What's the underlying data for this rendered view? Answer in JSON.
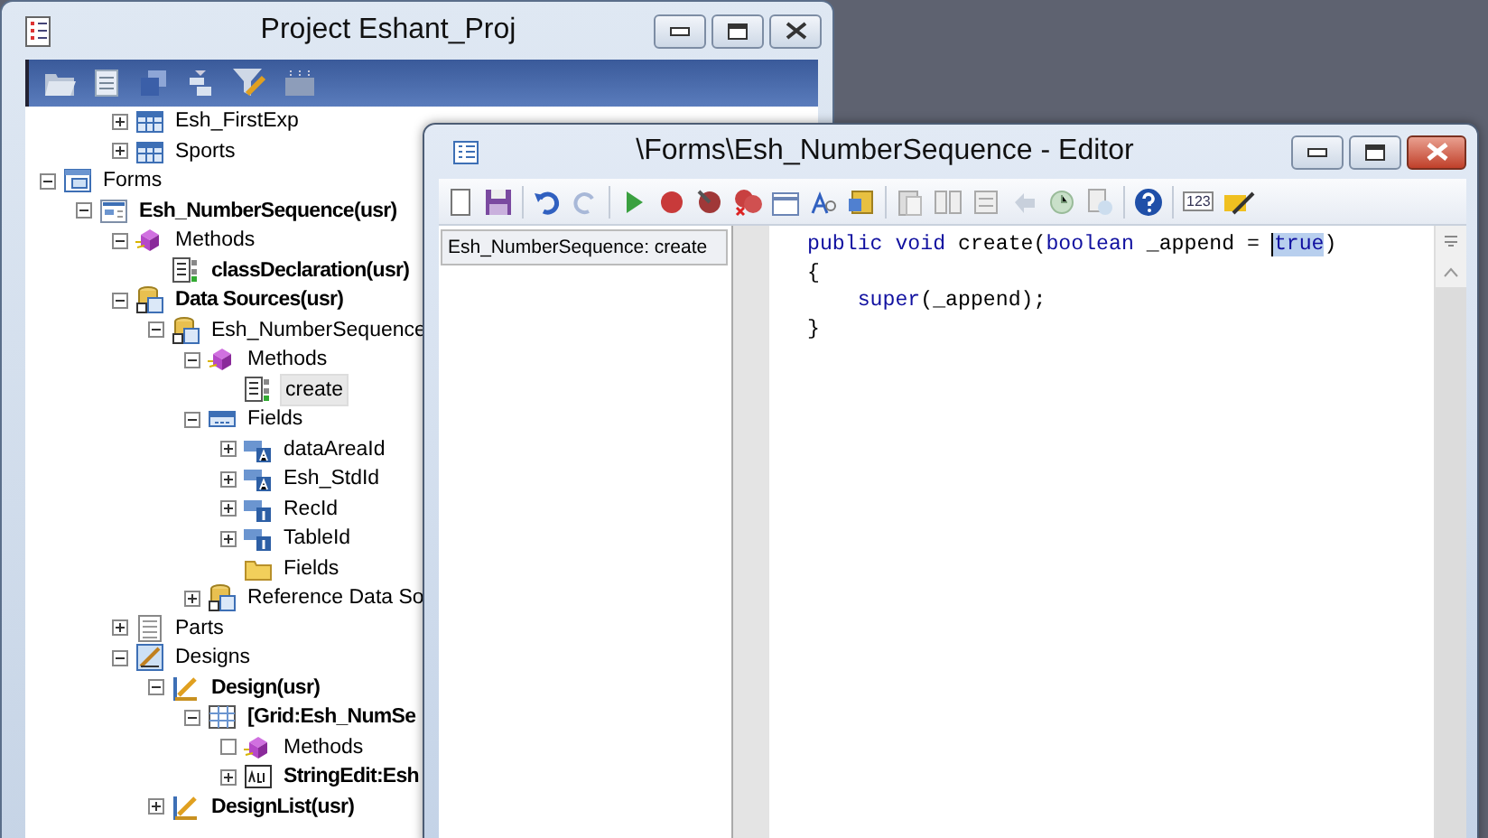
{
  "project_window": {
    "title": "Project Eshant_Proj",
    "tree": {
      "partial_items": [
        {
          "label": "Esh_FirstExp",
          "kind": "table",
          "expanded": false,
          "bold": false,
          "selected": false
        },
        {
          "label": "Sports",
          "kind": "table",
          "expanded": false,
          "bold": false,
          "selected": false
        }
      ],
      "items": [
        {
          "label": "Forms",
          "kind": "forms",
          "expanded": true,
          "bold": false,
          "selected": false,
          "children": [
            {
              "label": "Esh_NumberSequence(usr)",
              "kind": "form",
              "expanded": true,
              "bold": true,
              "selected": false,
              "children": [
                {
                  "label": "Methods",
                  "kind": "methods",
                  "expanded": true,
                  "bold": false,
                  "selected": false,
                  "children": [
                    {
                      "label": "classDeclaration(usr)",
                      "kind": "method",
                      "bold": true,
                      "selected": false
                    }
                  ]
                },
                {
                  "label": "Data Sources(usr)",
                  "kind": "datasource",
                  "expanded": true,
                  "bold": true,
                  "selected": false,
                  "children": [
                    {
                      "label": "Esh_NumberSequence",
                      "kind": "datasource",
                      "expanded": true,
                      "bold": false,
                      "selected": false,
                      "children": [
                        {
                          "label": "Methods",
                          "kind": "methods",
                          "expanded": true,
                          "bold": false,
                          "selected": false,
                          "children": [
                            {
                              "label": "create",
                              "kind": "method",
                              "bold": false,
                              "selected": true
                            }
                          ]
                        },
                        {
                          "label": "Fields",
                          "kind": "fields",
                          "expanded": true,
                          "bold": false,
                          "selected": false,
                          "children": [
                            {
                              "label": "dataAreaId",
                              "kind": "field-string",
                              "expanded": false,
                              "bold": false,
                              "selected": false
                            },
                            {
                              "label": "Esh_StdId",
                              "kind": "field-string",
                              "expanded": false,
                              "bold": false,
                              "selected": false
                            },
                            {
                              "label": "RecId",
                              "kind": "field-int",
                              "expanded": false,
                              "bold": false,
                              "selected": false
                            },
                            {
                              "label": "TableId",
                              "kind": "field-int",
                              "expanded": false,
                              "bold": false,
                              "selected": false
                            },
                            {
                              "label": "Fields",
                              "kind": "folder",
                              "bold": false,
                              "selected": false
                            }
                          ]
                        },
                        {
                          "label": "Reference Data So",
                          "kind": "datasource",
                          "expanded": false,
                          "bold": false,
                          "selected": false
                        }
                      ]
                    }
                  ]
                },
                {
                  "label": "Parts",
                  "kind": "parts",
                  "expanded": false,
                  "bold": false,
                  "selected": false
                },
                {
                  "label": "Designs",
                  "kind": "designs",
                  "expanded": true,
                  "bold": false,
                  "selected": false,
                  "children": [
                    {
                      "label": "Design(usr)",
                      "kind": "design",
                      "expanded": true,
                      "bold": true,
                      "selected": false,
                      "children": [
                        {
                          "label": "[Grid:Esh_NumSe",
                          "kind": "grid",
                          "expanded": true,
                          "bold": true,
                          "selected": false,
                          "children": [
                            {
                              "label": "Methods",
                              "kind": "methods",
                              "empty": true,
                              "bold": false,
                              "selected": false
                            },
                            {
                              "label": "StringEdit:Esh",
                              "kind": "stringedit",
                              "expanded": false,
                              "bold": true,
                              "selected": false
                            }
                          ]
                        }
                      ]
                    },
                    {
                      "label": "DesignList(usr)",
                      "kind": "design",
                      "expanded": false,
                      "bold": true,
                      "selected": false
                    }
                  ]
                }
              ]
            }
          ]
        }
      ]
    }
  },
  "editor_window": {
    "title": "\\Forms\\Esh_NumberSequence - Editor",
    "toolbar_badge": "123",
    "method_tabs": [
      {
        "label": "Esh_NumberSequence: create",
        "selected": true
      }
    ],
    "code_lines": [
      {
        "tokens": [
          {
            "kind": "keyword",
            "text": "public void "
          },
          {
            "kind": "plain",
            "text": "create("
          },
          {
            "kind": "keyword",
            "text": "boolean"
          },
          {
            "kind": "plain",
            "text": " _append = "
          },
          {
            "kind": "selected",
            "text": "true"
          },
          {
            "kind": "plain",
            "text": ")"
          }
        ]
      },
      {
        "tokens": [
          {
            "kind": "plain",
            "text": "{"
          }
        ]
      },
      {
        "tokens": [
          {
            "kind": "keyword",
            "text": "    super"
          },
          {
            "kind": "plain",
            "text": "(_append);"
          }
        ]
      },
      {
        "tokens": [
          {
            "kind": "plain",
            "text": "}"
          }
        ]
      }
    ]
  }
}
